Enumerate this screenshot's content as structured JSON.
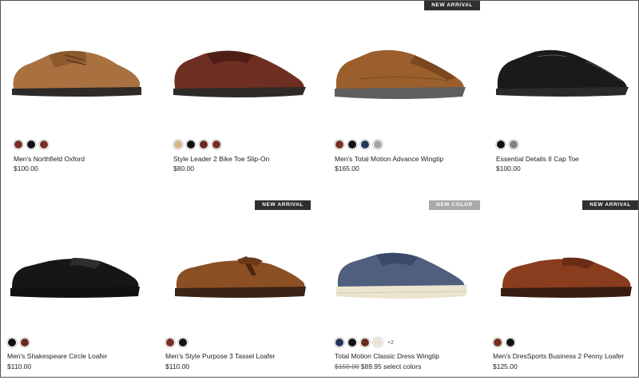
{
  "products": [
    {
      "name": "Men's Northfield Oxford",
      "price": "$100.00",
      "badge": "",
      "swatches": [
        "#7a2e22",
        "#111111",
        "#7a2e22"
      ],
      "more": ""
    },
    {
      "name": "Style Leader 2 Bike Toe Slip-On",
      "price": "$80.00",
      "badge": "",
      "swatches": [
        "#d8b48a",
        "#111111",
        "#6b2a20",
        "#7a2e22"
      ],
      "more": ""
    },
    {
      "name": "Men's Total Motion Advance Wingtip",
      "price": "$165.00",
      "badge": "NEW ARRIVAL",
      "swatches": [
        "#7a2e22",
        "#111111",
        "#27355f",
        "#a6a6a6"
      ],
      "more": ""
    },
    {
      "name": "Essential Details II Cap Toe",
      "price": "$100.00",
      "badge": "",
      "swatches": [
        "#111111",
        "#8a7f78"
      ],
      "more": ""
    },
    {
      "name": "Men's Shakespeare Circle Loafer",
      "price": "$110.00",
      "badge": "",
      "swatches": [
        "#111111",
        "#6b2a20"
      ],
      "more": ""
    },
    {
      "name": "Men's Style Purpose 3 Tassel Loafer",
      "price": "$110.00",
      "badge": "NEW ARRIVAL",
      "swatches": [
        "#7a2e22",
        "#111111"
      ],
      "more": ""
    },
    {
      "name": "Total Motion Classic Dress Wingtip",
      "price_original": "$150.00",
      "price": "$89.95 select colors",
      "badge": "NEW COLOR",
      "swatches": [
        "#27355f",
        "#111111",
        "#6b2a20",
        "#ece4d0"
      ],
      "more": "+2"
    },
    {
      "name": "Men's DresSports Business 2 Penny Loafer",
      "price": "$125.00",
      "badge": "NEW ARRIVAL",
      "swatches": [
        "#7a2e22",
        "#111111"
      ],
      "more": ""
    }
  ]
}
